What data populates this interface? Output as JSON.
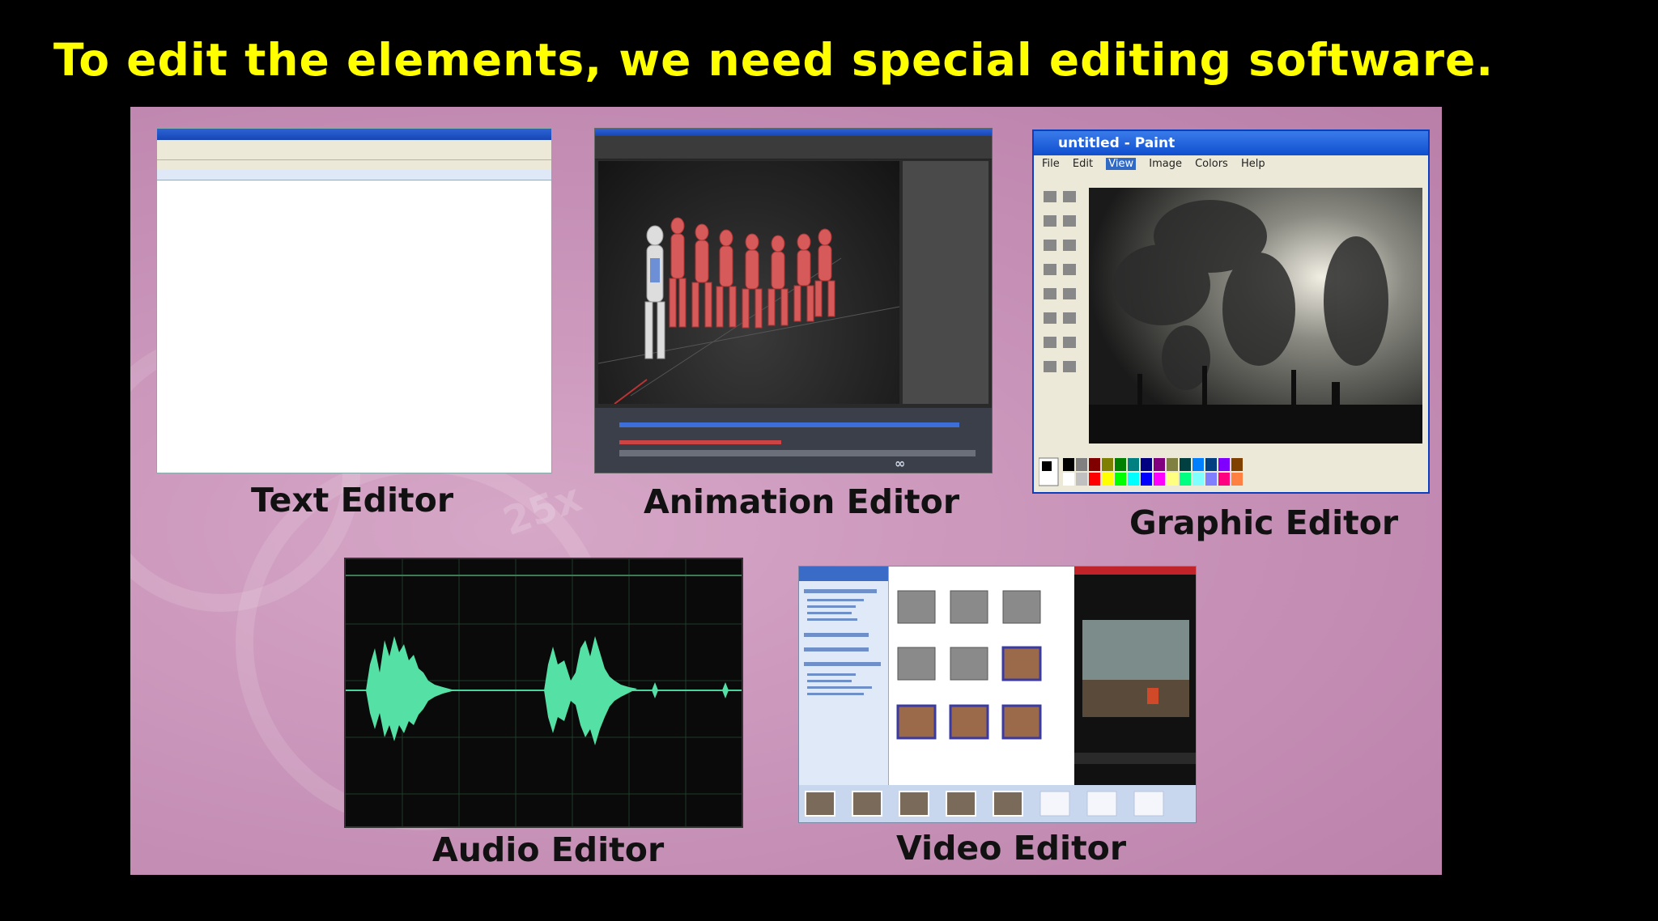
{
  "slide": {
    "headline": "To edit the elements, we need special editing software.",
    "headline_color": "#ffff00",
    "background_color": "#000000",
    "board_color": "#c994b9"
  },
  "editors": [
    {
      "label": "Text Editor",
      "icon": "word-processor-window"
    },
    {
      "label": "Animation Editor",
      "icon": "3d-animation-window"
    },
    {
      "label": "Graphic Editor",
      "icon": "paint-window"
    },
    {
      "label": "Audio Editor",
      "icon": "waveform-display"
    },
    {
      "label": "Video Editor",
      "icon": "movie-maker-window"
    }
  ],
  "screenshots": {
    "paint_title": "untitled - Paint",
    "paint_menu": [
      "File",
      "Edit",
      "View",
      "Image",
      "Colors",
      "Help"
    ],
    "watermark": "25x"
  }
}
